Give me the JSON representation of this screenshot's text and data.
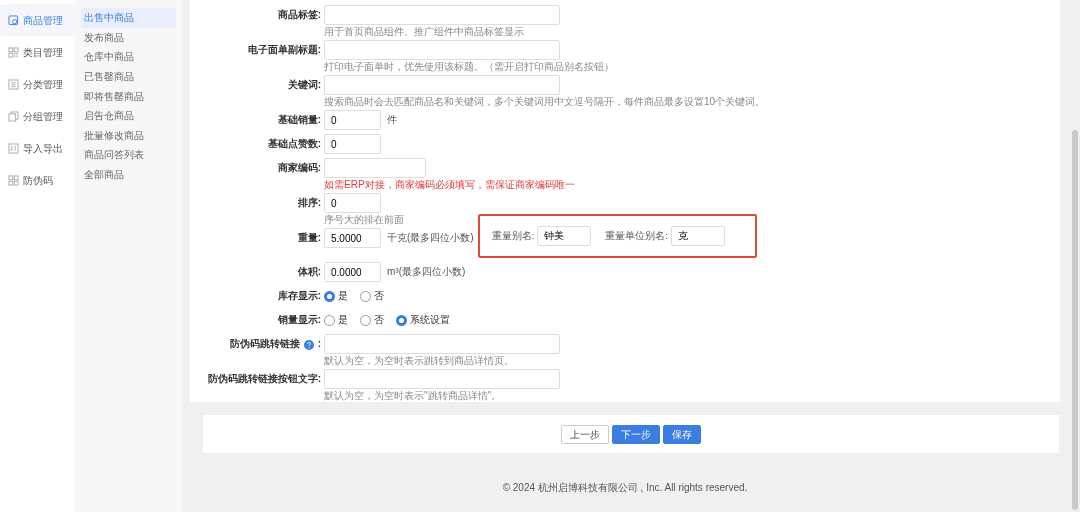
{
  "sidebar": {
    "items": [
      {
        "label": "商品管理",
        "selected": true
      },
      {
        "label": "类目管理",
        "selected": false
      },
      {
        "label": "分类管理",
        "selected": false
      },
      {
        "label": "分组管理",
        "selected": false
      },
      {
        "label": "导入导出",
        "selected": false
      },
      {
        "label": "防伪码",
        "selected": false
      }
    ]
  },
  "submenu": {
    "items": [
      {
        "label": "出售中商品",
        "selected": true
      },
      {
        "label": "发布商品",
        "selected": false
      },
      {
        "label": "仓库中商品",
        "selected": false
      },
      {
        "label": "已售罄商品",
        "selected": false
      },
      {
        "label": "即将售罄商品",
        "selected": false
      },
      {
        "label": "启告仓商品",
        "selected": false
      },
      {
        "label": "批量修改商品",
        "selected": false
      },
      {
        "label": "商品问答列表",
        "selected": false
      },
      {
        "label": "全部商品",
        "selected": false
      }
    ]
  },
  "form": {
    "fields": [
      {
        "kind": "text",
        "label": "商品标签:",
        "help": "用于首页商品组件、推广组件中商品标签显示"
      },
      {
        "kind": "text",
        "label": "电子面单副标题:",
        "help": "打印电子面单时，优先使用该标题。（需开启打印商品别名按钮）"
      },
      {
        "kind": "text",
        "label": "关键词:",
        "help": "搜索商品时会去匹配商品名和关键词，多个关键词用中文逗号隔开，每件商品最多设置10个关键词。"
      },
      {
        "kind": "number",
        "label": "基础销量:",
        "value": "0",
        "suffix": "件"
      },
      {
        "kind": "number",
        "label": "基础点赞数:",
        "value": "0"
      },
      {
        "kind": "code",
        "label": "商家编码:",
        "help": "如需ERP对接，商家编码必须填写，需保证商家编码唯一",
        "help_warning": true
      },
      {
        "kind": "number",
        "label": "排序:",
        "value": "0",
        "help": "序号大的排在前面"
      },
      {
        "kind": "number",
        "label": "重量:",
        "value": "5.0000",
        "suffix": "千克(最多四位小数)",
        "highlighted": true,
        "extras": [
          {
            "label": "重量别名:",
            "value": "钟美"
          },
          {
            "label": "重量单位别名:",
            "value": "克"
          }
        ]
      },
      {
        "kind": "number",
        "label": "体积:",
        "value": "0.0000",
        "suffix": "m³(最多四位小数)"
      },
      {
        "kind": "radio",
        "label": "库存显示:",
        "options": [
          {
            "label": "是",
            "selected": true
          },
          {
            "label": "否",
            "selected": false
          }
        ]
      },
      {
        "kind": "radio",
        "label": "销量显示:",
        "options": [
          {
            "label": "是",
            "selected": false
          },
          {
            "label": "否",
            "selected": false
          },
          {
            "label": "系统设置",
            "selected": true
          }
        ]
      },
      {
        "kind": "text",
        "label": "防伪码跳转链接",
        "info": true,
        "label_end": ":",
        "help": "默认为空，为空时表示跳转到商品详情页。"
      },
      {
        "kind": "text",
        "label": "防伪码跳转链接按钮文字:",
        "help": "默认为空，为空时表示\"跳转商品详情\"。"
      }
    ]
  },
  "buttons": [
    {
      "label": "上一步",
      "kind": "default"
    },
    {
      "label": "下一步",
      "kind": "primary"
    },
    {
      "label": "保存",
      "kind": "primary"
    }
  ],
  "footer": "© 2024 杭州启博科技有限公司 , Inc. All rights reserved."
}
